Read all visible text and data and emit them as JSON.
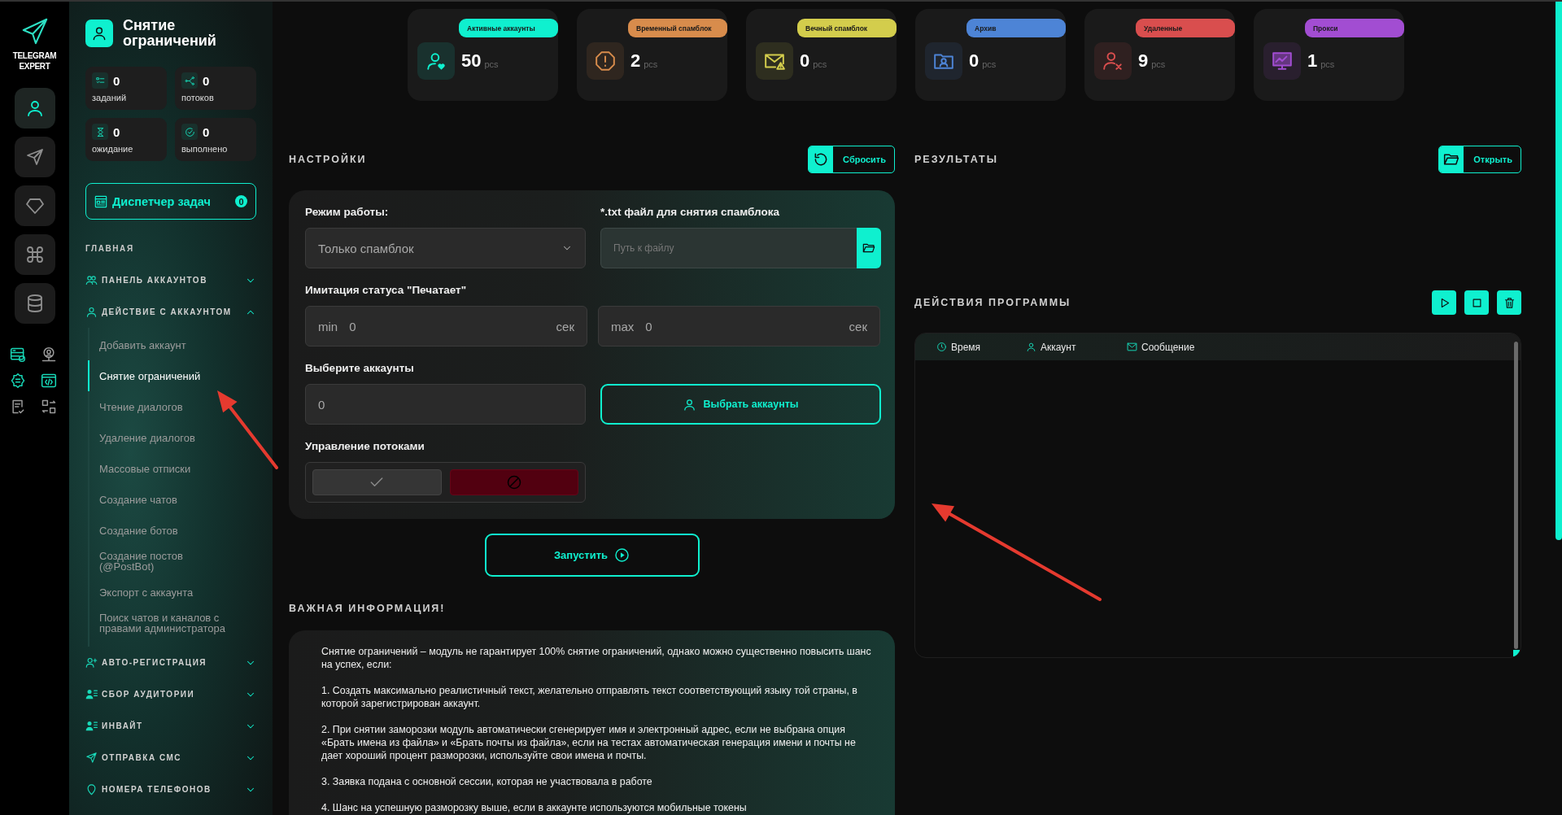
{
  "rail": {
    "logo": "TELEGRAM EXPERT",
    "items": [
      {
        "kind": "user",
        "selected": true
      },
      {
        "kind": "send",
        "selected": false
      },
      {
        "kind": "diamond",
        "selected": false
      },
      {
        "kind": "command",
        "selected": false
      },
      {
        "kind": "database",
        "selected": false
      }
    ]
  },
  "page_title": "Снятие ограничений",
  "counters": [
    {
      "kind": "tasks",
      "value": "0",
      "label": "заданий"
    },
    {
      "kind": "threads",
      "value": "0",
      "label": "потоков"
    },
    {
      "kind": "waiting",
      "value": "0",
      "label": "ожидание"
    },
    {
      "kind": "done",
      "value": "0",
      "label": "выполнено"
    }
  ],
  "task_manager": {
    "label": "Диспетчер задач",
    "count": "0"
  },
  "nav": {
    "heading": "ГЛАВНАЯ",
    "groups": [
      {
        "kind": "users",
        "label": "ПАНЕЛЬ АККАУНТОВ",
        "expanded": false
      },
      {
        "kind": "user",
        "label": "ДЕЙСТВИЕ С АККАУНТОМ",
        "expanded": true,
        "children": [
          {
            "label": "Добавить аккаунт",
            "selected": false
          },
          {
            "label": "Снятие ограничений",
            "selected": true
          },
          {
            "label": "Чтение диалогов",
            "selected": false
          },
          {
            "label": "Удаление диалогов",
            "selected": false
          },
          {
            "label": "Массовые отписки",
            "selected": false
          },
          {
            "label": "Создание чатов",
            "selected": false
          },
          {
            "label": "Создание ботов",
            "selected": false
          },
          {
            "label": "Создание постов (@PostBot)",
            "selected": false
          },
          {
            "label": "Экспорт с аккаунта",
            "selected": false
          },
          {
            "label": "Поиск чатов и каналов с правами администратора",
            "selected": false
          }
        ]
      },
      {
        "kind": "user-add",
        "label": "АВТО-РЕГИСТРАЦИЯ",
        "expanded": false
      },
      {
        "kind": "user-list",
        "label": "СБОР АУДИТОРИИ",
        "expanded": false
      },
      {
        "kind": "user-list",
        "label": "ИНВАЙТ",
        "expanded": false
      },
      {
        "kind": "send",
        "label": "ОТПРАВКА СМС",
        "expanded": false
      },
      {
        "kind": "pin",
        "label": "НОМЕРА ТЕЛЕФОНОВ",
        "expanded": false
      }
    ]
  },
  "stats": [
    {
      "kind": "active",
      "label": "Активные аккаунты",
      "color": "#0ff0cf",
      "value": "50",
      "unit": "pcs"
    },
    {
      "kind": "warning",
      "label": "Временный спамблок",
      "color": "#d88c4c",
      "value": "2",
      "unit": "pcs"
    },
    {
      "kind": "mail",
      "label": "Вечный спамблок",
      "color": "#d3cd4c",
      "value": "0",
      "unit": "pcs"
    },
    {
      "kind": "archive",
      "label": "Архив",
      "color": "#4d84d6",
      "value": "0",
      "unit": "pcs"
    },
    {
      "kind": "deleted",
      "label": "Удаленные",
      "color": "#d94e4e",
      "value": "9",
      "unit": "pcs"
    },
    {
      "kind": "proxy",
      "label": "Прокси",
      "color": "#a24dd2",
      "value": "1",
      "unit": "pcs"
    }
  ],
  "settings": {
    "title": "НАСТРОЙКИ",
    "reset_button": "Сбросить",
    "mode": {
      "label": "Режим работы:",
      "value": "Только спамблок"
    },
    "file": {
      "label": "*.txt файл для снятия спамблока",
      "placeholder": "Путь к файлу"
    },
    "typing": {
      "label": "Имитация статуса \"Печатает\"",
      "min": {
        "prefix": "min",
        "value": "0",
        "unit": "сек"
      },
      "max": {
        "prefix": "max",
        "value": "0",
        "unit": "сек"
      }
    },
    "accounts": {
      "label": "Выберите аккаунты",
      "value": "0",
      "button": "Выбрать аккаунты"
    },
    "threads": {
      "label": "Управление потоками",
      "options": [
        {
          "kind": "enable",
          "selected": false
        },
        {
          "kind": "disable",
          "selected": true
        }
      ]
    }
  },
  "start_button": "Запустить",
  "info": {
    "title": "ВАЖНАЯ ИНФОРМАЦИЯ!",
    "paragraphs": [
      "Снятие ограничений – модуль не гарантирует 100% снятие ограничений, однако можно существенно повысить шанс на успех, если:",
      "1. Создать максимально реалистичный текст, желательно отправлять текст соответствующий языку той страны, в которой зарегистрирован аккаунт.",
      "2. При снятии заморозки модуль автоматически сгенерирует имя и электронный адрес, если не выбрана опция «Брать имена из файла» и «Брать почты из файла», если на тестах автоматическая генерация имени и почты не дает хороший процент разморозки, используйте свои имена и почты.",
      "3. Заявка подана с основной сессии, которая не участвовала в работе",
      "4. Шанс на успешную разморозку выше, если в аккаунте используются мобильные токены"
    ]
  },
  "results": {
    "title": "РЕЗУЛЬТАТЫ",
    "open_button": "Открыть"
  },
  "actions": {
    "title": "ДЕЙСТВИЯ ПРОГРАММЫ",
    "controls": [
      {
        "kind": "play"
      },
      {
        "kind": "stop"
      },
      {
        "kind": "delete"
      }
    ],
    "columns": [
      {
        "kind": "time",
        "label": "Время"
      },
      {
        "kind": "account",
        "label": "Аккаунт"
      },
      {
        "kind": "message",
        "label": "Сообщение"
      }
    ]
  },
  "annotations": [
    {
      "kind": "arrow",
      "color": "#e53a2f"
    },
    {
      "kind": "arrow",
      "color": "#e53a2f"
    }
  ]
}
